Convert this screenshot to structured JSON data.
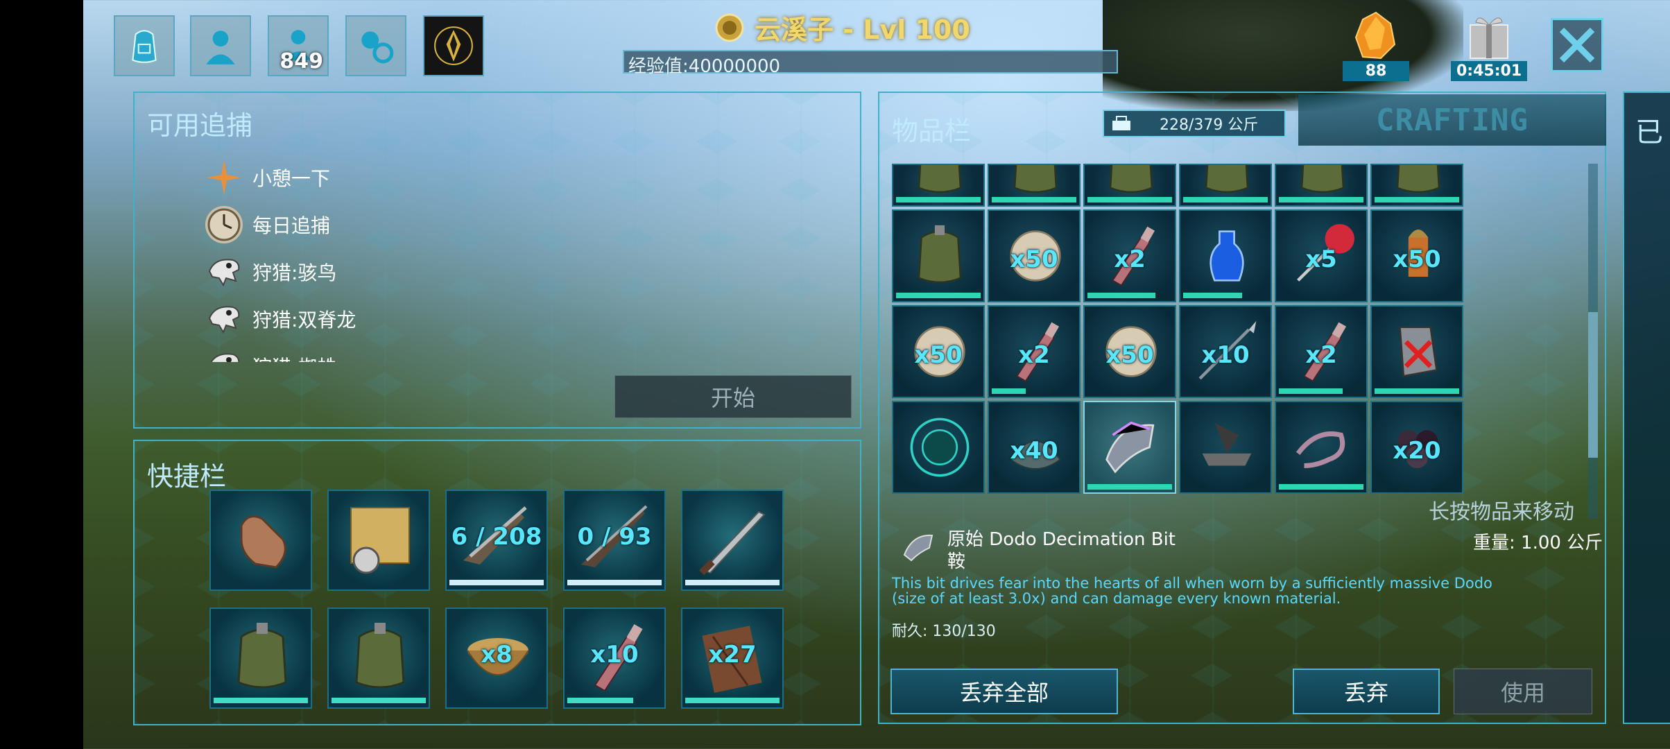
{
  "topbar": {
    "icons": [
      {
        "name": "backpack-icon"
      },
      {
        "name": "character-icon"
      },
      {
        "name": "tribe-icon",
        "count": "849"
      },
      {
        "name": "engrams-icon"
      },
      {
        "name": "obelisk-icon"
      }
    ],
    "player_title": "云溪子 - Lvl 100",
    "xp_text": "经验值:40000000",
    "crystals": "88",
    "gift_timer": "0:45:01"
  },
  "bounties": {
    "title": "可用追捕",
    "items": [
      {
        "icon": "compass-star-icon",
        "label": "小憩一下"
      },
      {
        "icon": "clock-icon",
        "label": "每日追捕"
      },
      {
        "icon": "dino-skull-icon",
        "label": "狩猎:骇鸟"
      },
      {
        "icon": "dino-skull-icon",
        "label": "狩猎:双脊龙"
      },
      {
        "icon": "dino-skull-icon",
        "label": "狩猎:蜘蛛"
      }
    ],
    "start_label": "开始"
  },
  "hotbar": {
    "title": "快捷栏",
    "slots": [
      {
        "name": "hand-icon",
        "qty": "",
        "durability": null
      },
      {
        "name": "map-compass-icon",
        "qty": "",
        "durability": null
      },
      {
        "name": "shotgun-icon",
        "qty": "6 / 208",
        "durability": 1.0
      },
      {
        "name": "rifle-icon",
        "qty": "0 / 93",
        "durability": 1.0
      },
      {
        "name": "sword-icon",
        "qty": "",
        "durability": 1.0
      },
      {
        "name": "canteen-icon",
        "qty": "",
        "durability": 1.0
      },
      {
        "name": "canteen-icon",
        "qty": "",
        "durability": 1.0
      },
      {
        "name": "bowl-icon",
        "qty": "x8",
        "durability": null
      },
      {
        "name": "bottle-icon",
        "qty": "x10",
        "durability": 0.7
      },
      {
        "name": "wood-icon",
        "qty": "x27",
        "durability": 1.0
      }
    ]
  },
  "inventory": {
    "title": "物品栏",
    "weight": "228/379 公斤",
    "crafting_tab": "CRAFTING",
    "move_hint": "长按物品来移动",
    "rows": [
      [
        {
          "name": "canteen-icon",
          "qty": "",
          "durability": 1.0
        },
        {
          "name": "canteen-icon",
          "qty": "",
          "durability": 1.0
        },
        {
          "name": "canteen-icon",
          "qty": "",
          "durability": 1.0
        },
        {
          "name": "canteen-icon",
          "qty": "",
          "durability": 1.0
        },
        {
          "name": "canteen-icon",
          "qty": "",
          "durability": 1.0
        },
        {
          "name": "canteen-icon",
          "qty": "",
          "durability": 1.0
        }
      ],
      [
        {
          "name": "canteen-icon",
          "qty": "",
          "durability": 1.0
        },
        {
          "name": "stone-ball-icon",
          "qty": "x50",
          "durability": null
        },
        {
          "name": "bottle-icon",
          "qty": "x2",
          "durability": 0.8
        },
        {
          "name": "blue-potion-icon",
          "qty": "",
          "durability": 0.7
        },
        {
          "name": "dart-icon",
          "qty": "x5",
          "durability": null
        },
        {
          "name": "bullet-icon",
          "qty": "x50",
          "durability": null
        }
      ],
      [
        {
          "name": "stone-ball-icon",
          "qty": "x50",
          "durability": null
        },
        {
          "name": "bottle-icon",
          "qty": "x2",
          "durability": 0.4
        },
        {
          "name": "stone-ball-icon",
          "qty": "x50",
          "durability": null
        },
        {
          "name": "spear-icon",
          "qty": "x10",
          "durability": null
        },
        {
          "name": "bottle-icon",
          "qty": "x2",
          "durability": 0.75
        },
        {
          "name": "gauntlet-icon",
          "qty": "",
          "durability": 1.0
        }
      ],
      [
        {
          "name": "gorilla-trophy-icon",
          "qty": "",
          "durability": null
        },
        {
          "name": "fiber-icon",
          "qty": "x40",
          "durability": null
        },
        {
          "name": "saddle-icon",
          "qty": "",
          "durability": 1.0
        },
        {
          "name": "anvil-icon",
          "qty": "",
          "durability": null
        },
        {
          "name": "tentacle-icon",
          "qty": "",
          "durability": 1.0
        },
        {
          "name": "black-pearl-icon",
          "qty": "x20",
          "durability": null
        }
      ]
    ],
    "selected": {
      "name_line1": "原始 Dodo Decimation Bit",
      "name_line2": "鞍",
      "weight": "重量: 1.00 公斤",
      "description": "This bit drives fear into the hearts of all when worn by a sufficiently massive Dodo (size of at least 3.0x) and can damage every known material.",
      "durability": "耐久: 130/130"
    },
    "buttons": {
      "drop_all": "丢弃全部",
      "drop": "丢弃",
      "use": "使用"
    }
  },
  "side_panel": {
    "label": "已"
  }
}
